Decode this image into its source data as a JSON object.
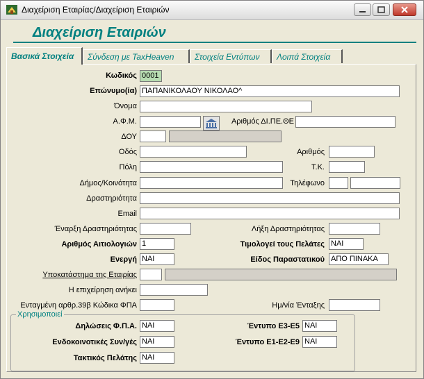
{
  "window": {
    "title": "Διαχείριση Εταιρίας/Διαχείριση Εταιριών"
  },
  "header": {
    "title": "Διαχείριση Εταιριών"
  },
  "tabs": [
    {
      "label": "Βασικά Στοιχεία",
      "active": true
    },
    {
      "label": "Σύνδεση με TaxHeaven",
      "active": false
    },
    {
      "label": "Στοιχεία Εντύπων",
      "active": false
    },
    {
      "label": "Λοιπά Στοιχεία",
      "active": false
    }
  ],
  "fields": {
    "kodikos": {
      "label": "Κωδικός",
      "value": "0001"
    },
    "eponymo": {
      "label": "Επώνυμο(ία)",
      "value": "ΠΑΠΑΝΙΚΟΛΑΟΥ ΝΙΚΟΛΑΟ^"
    },
    "onoma": {
      "label": "Όνομα",
      "value": ""
    },
    "afm": {
      "label": "Α.Φ.Μ.",
      "value": ""
    },
    "arithmos_dipeth": {
      "label": "Αριθμός ΔΙ.ΠΕ.ΘΕ",
      "value": ""
    },
    "doy": {
      "label": "ΔΟΥ",
      "value": "",
      "name_value": ""
    },
    "odos": {
      "label": "Οδός",
      "value": ""
    },
    "arithmos": {
      "label": "Αριθμός",
      "value": ""
    },
    "poli": {
      "label": "Πόλη",
      "value": ""
    },
    "tk": {
      "label": "Τ.Κ.",
      "value": ""
    },
    "dimos": {
      "label": "Δήμος/Κοινότητα",
      "value": ""
    },
    "tilefono": {
      "label": "Τηλέφωνο",
      "value": "",
      "value2": ""
    },
    "drastiriotita": {
      "label": "Δραστηριότητα",
      "value": ""
    },
    "email": {
      "label": "Email",
      "value": ""
    },
    "enarxi": {
      "label": "Έναρξη Δραστηριότητας",
      "value": ""
    },
    "lixi": {
      "label": "Λήξη Δραστηριότητας",
      "value": ""
    },
    "arithmos_aitiologion": {
      "label": "Αριθμός Αιτιολογιών",
      "value": "1"
    },
    "timologei": {
      "label": "Τιμολογεί τους Πελάτες",
      "value": "ΝΑΙ"
    },
    "energi": {
      "label": "Ενεργή",
      "value": "ΝΑΙ"
    },
    "eidos_parastatikou": {
      "label": "Είδος Παραστατικού",
      "value": "ΑΠΟ ΠΙΝΑΚΑ"
    },
    "ypokatastima": {
      "label": "Υποκατάστημα της Εταιρίας",
      "value": "",
      "name_value": ""
    },
    "anikei": {
      "label": "Η επιχείρηση ανήκει",
      "value": ""
    },
    "entagmeni": {
      "label": "Ενταγμένη αρθρ.39β Κώδικα ΦΠΑ",
      "value": ""
    },
    "hmnia_entaxis": {
      "label": "Ημ/νία Ένταξης",
      "value": ""
    }
  },
  "group": {
    "label": "Χρησιμοποιεί",
    "dilosis_fpa": {
      "label": "Δηλώσεις Φ.Π.Α.",
      "value": "ΝΑΙ"
    },
    "entypo_e3": {
      "label": "Έντυπο Ε3-Ε5",
      "value": "ΝΑΙ"
    },
    "endokoinotikes": {
      "label": "Ενδοκοινοτικές Συν/γές",
      "value": "ΝΑΙ"
    },
    "entypo_e1": {
      "label": "Έντυπο Ε1-Ε2-Ε9",
      "value": "ΝΑΙ"
    },
    "taktikos": {
      "label": "Τακτικός Πελάτης",
      "value": "ΝΑΙ"
    }
  },
  "icons": {
    "app": "app-icon",
    "afm_lookup": "taxis-lookup-icon",
    "minimize": "minimize-icon",
    "maximize": "maximize-icon",
    "close": "close-icon"
  },
  "colors": {
    "accent": "#008080",
    "window_bg": "#ece9d8",
    "close": "#c0392b",
    "code_field": "#b7dcb1"
  }
}
